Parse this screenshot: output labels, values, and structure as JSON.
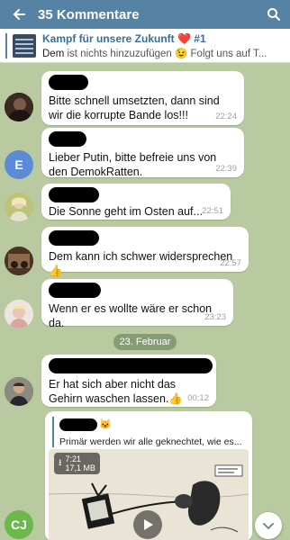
{
  "header": {
    "title": "35 Kommentare"
  },
  "pinned": {
    "title": "Kampf für unsere Zukunft ❤️ #1",
    "sender": "Dem",
    "text": " ist nichts hinzuzufügen 😉 Folgt uns auf T..."
  },
  "messages": [
    {
      "text": "Bitte schnell umsetzten, dann sind wir die korrupte Bande los!!!",
      "time": "22:24"
    },
    {
      "text": "Lieber Putin, bitte befreie uns von den DemokRatten.",
      "time": "22:39",
      "avatar_letter": "E"
    },
    {
      "text": "Die Sonne geht im Osten auf...",
      "time": "22:51"
    },
    {
      "text": "Dem kann ich schwer widersprechen👍",
      "time": "22:57"
    },
    {
      "text": "Wenn er es wollte wäre er schon da.",
      "time": "23:23"
    },
    {
      "text": "Er hat sich aber nicht das Gehirn waschen lassen.👍",
      "time": "00:12"
    }
  ],
  "date_separator": "23. Februar",
  "forwarded": {
    "emoji": "🐱",
    "text": "Primär werden wir alle geknechtet, wie es...",
    "duration": "7:21",
    "size": "17,1 MB"
  },
  "bottom_avatar": "CJ",
  "colors": {
    "header": "#5682a3",
    "background": "#b9c9a0",
    "avatar_e": "#5b8bd4",
    "avatar_cj": "#6cb84d"
  }
}
